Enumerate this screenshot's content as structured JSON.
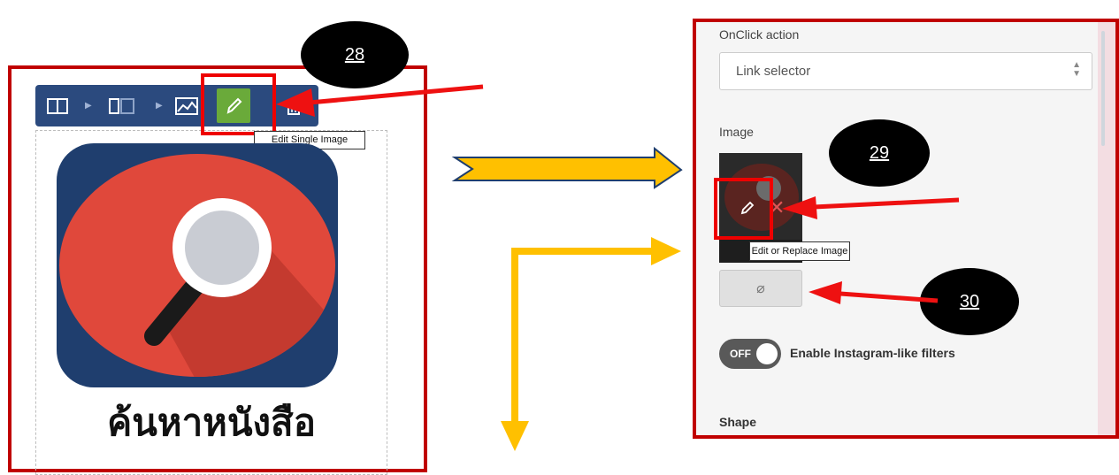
{
  "left_panel": {
    "toolbar": {
      "icons": [
        "column-icon",
        "columns-icon",
        "image-icon",
        "pencil-icon",
        "trash-icon"
      ],
      "edit_tooltip": "Edit Single Image"
    },
    "app_title": "ค้นหาหนังสือ"
  },
  "callouts": {
    "c28": "28",
    "c29": "29",
    "c30": "30"
  },
  "right_panel": {
    "onclick_label": "OnClick action",
    "link_selector_value": "Link selector",
    "image_label": "Image",
    "edit_tooltip": "Edit or Replace Image",
    "toggle_state": "OFF",
    "toggle_label": "Enable Instagram-like filters",
    "shape_label": "Shape"
  },
  "colors": {
    "highlight_red": "#c00000",
    "arrow_red": "#ee1111",
    "arrow_gold": "#ffc000",
    "toolbar_blue": "#2b4a7e",
    "edit_green": "#6aaa3a",
    "icon_red": "#e0483b",
    "icon_navy": "#1f3e6e"
  }
}
